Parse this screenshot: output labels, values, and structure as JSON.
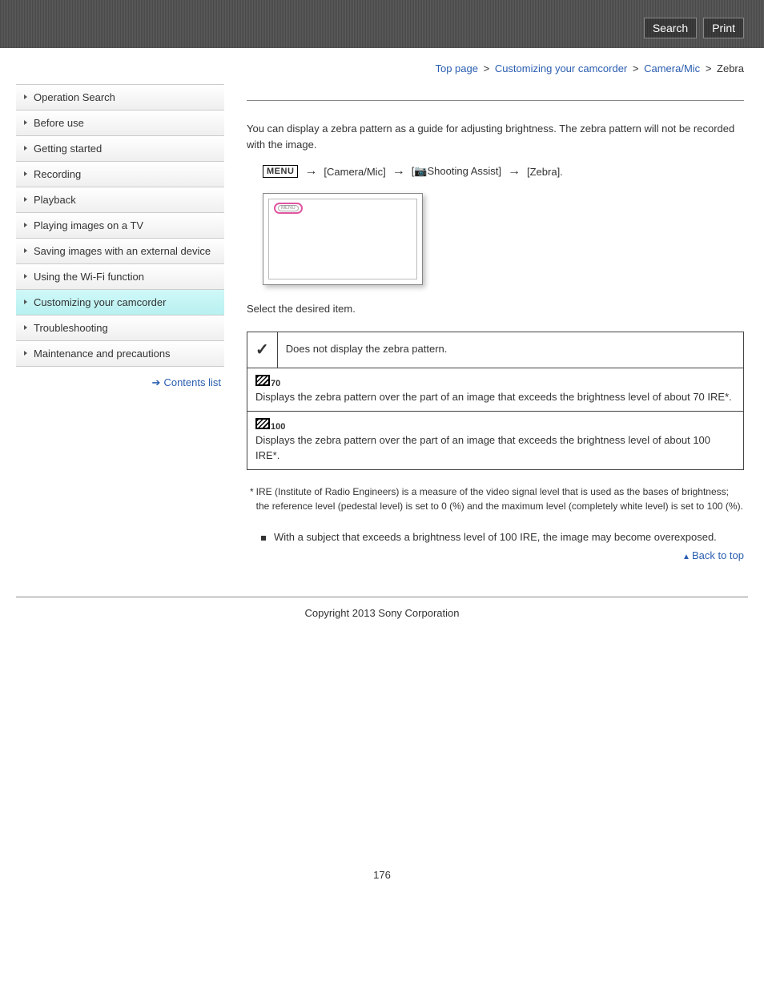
{
  "header": {
    "search": "Search",
    "print": "Print"
  },
  "breadcrumb": {
    "top": "Top page",
    "l1": "Customizing your camcorder",
    "l2": "Camera/Mic",
    "current": "Zebra"
  },
  "sidebar": {
    "items": [
      "Operation Search",
      "Before use",
      "Getting started",
      "Recording",
      "Playback",
      "Playing images on a TV",
      "Saving images with an external device",
      "Using the Wi-Fi function",
      "Customizing your camcorder",
      "Troubleshooting",
      "Maintenance and precautions"
    ],
    "active_index": 8,
    "contents_link": "Contents list"
  },
  "content": {
    "intro": "You can display a zebra pattern as a guide for adjusting brightness. The zebra pattern will not be recorded with the image.",
    "menu_button": "MENU",
    "path_step1": "[Camera/Mic]",
    "path_step2_suffix": "Shooting Assist]",
    "path_step3": "[Zebra].",
    "preview_menu_label": "MENU",
    "select_prompt": "Select the desired item.",
    "options": {
      "off_desc": "Does not display the zebra pattern.",
      "opt70_label": "70",
      "opt70_desc": "Displays the zebra pattern over the part of an image that exceeds the brightness level of about 70 IRE*.",
      "opt100_label": "100",
      "opt100_desc": "Displays the zebra pattern over the part of an image that exceeds the brightness level of about 100 IRE*."
    },
    "footnote": "IRE (Institute of Radio Engineers) is a measure of the video signal level that is used as the bases of brightness; the reference level (pedestal level) is set to 0 (%) and the maximum level (completely white level) is set to 100 (%).",
    "note_bullet": "With a subject that exceeds a brightness level of 100 IRE, the image may become overexposed.",
    "back_to_top": "Back to top"
  },
  "footer": {
    "copyright": "Copyright 2013 Sony Corporation",
    "page_number": "176"
  }
}
